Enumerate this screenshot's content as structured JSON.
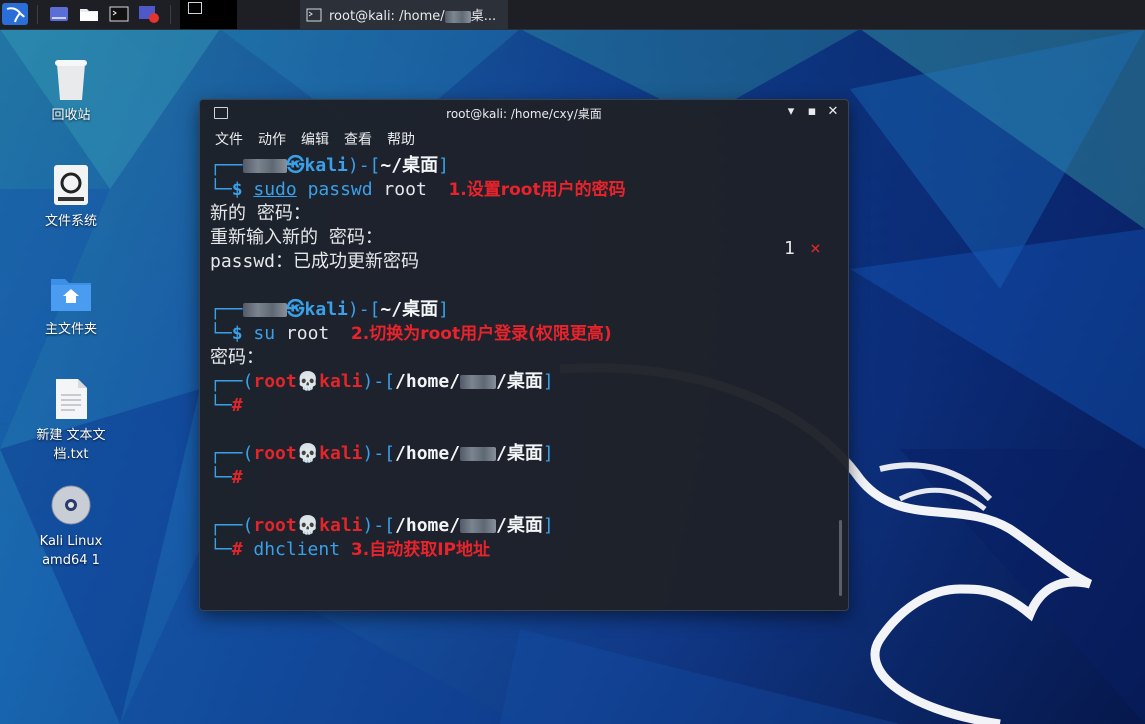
{
  "taskbar": {
    "task_title": "root@kali: /home/",
    "task_title_suffix": "桌..."
  },
  "desktop": {
    "icons": [
      {
        "label": "回收站"
      },
      {
        "label": "文件系统"
      },
      {
        "label": "主文件夹"
      },
      {
        "label": "新建 文本文档.txt"
      },
      {
        "label": "Kali Linux amd64 1"
      }
    ]
  },
  "terminal": {
    "title": "root@kali: /home/cxy/桌面",
    "menu": [
      "文件",
      "动作",
      "编辑",
      "查看",
      "帮助"
    ],
    "lines": {
      "p1_host": "kali",
      "p1_dir": "~/桌面",
      "cmd1": "sudo passwd root",
      "anno1": "1.设置root用户的密码",
      "status_num": "1",
      "status_x": "×",
      "out1": "新的 密码：",
      "out2": "重新输入新的 密码：",
      "out3": "passwd：已成功更新密码",
      "p2_host": "kali",
      "p2_dir": "~/桌面",
      "cmd2": "su root",
      "anno2": "2.切换为root用户登录(权限更高)",
      "out4": "密码：",
      "root_user": "root",
      "root_host": "kali",
      "root_dir_prefix": "/home/",
      "root_dir_suffix": "/桌面",
      "hash": "#",
      "dollar": "$",
      "cmd3": "dhclient",
      "anno3": "3.自动获取IP地址"
    }
  }
}
